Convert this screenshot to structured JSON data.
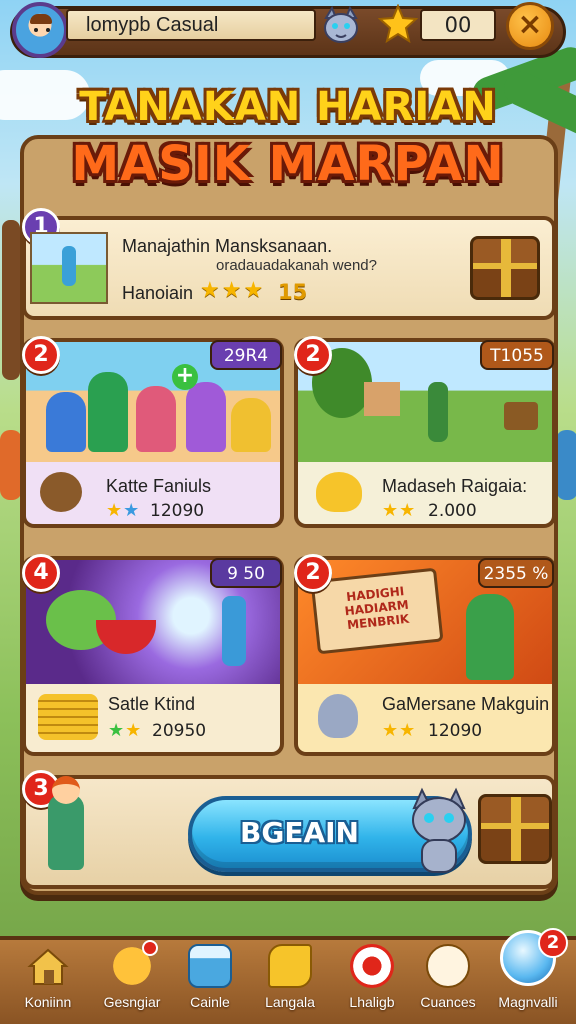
{
  "header": {
    "player_name": "lomypb Casual",
    "score": "00",
    "close_label": "×"
  },
  "titles": {
    "line1": "TANAKAN HARIAN",
    "line2": "MASIK MARPAN"
  },
  "featured_task": {
    "badge": "1",
    "title": "Manajathin Mansksanaan.",
    "subtitle": "oradauadakanah wend?",
    "name": "Hanoiain",
    "stars": "★★★",
    "value": "15"
  },
  "tasks": [
    {
      "badge": "2",
      "tag": "29R4",
      "label": "Katte Faniuls",
      "stars": "★★",
      "value": "12090",
      "tag_color": "#6a3fb0"
    },
    {
      "badge": "2",
      "tag": "T1055",
      "label": "Madaseh Raigaia:",
      "stars": "★★",
      "value": "2.000",
      "tag_color": "#b0581a"
    },
    {
      "badge": "4",
      "tag": "9 50",
      "label": "Satle Ktind",
      "stars": "★★",
      "value": "20950",
      "tag_color": "#5a3aa0"
    },
    {
      "badge": "2",
      "tag": "2355 %",
      "label": "GaMersane Makguin",
      "stars": "★★",
      "value": "12090",
      "tag_color": "#b0581a"
    }
  ],
  "sign_text": "HADIGHI\nHADIARM\nMENBRIK",
  "bottom": {
    "badge": "3",
    "begin_label": "BGEAIN"
  },
  "nav": [
    {
      "label": "Koniinn",
      "icon": "home-icon"
    },
    {
      "label": "Gesngiar",
      "icon": "character-icon"
    },
    {
      "label": "Cainle",
      "icon": "basket-icon"
    },
    {
      "label": "Langala",
      "icon": "cheese-icon"
    },
    {
      "label": "Lhaligb",
      "icon": "target-icon"
    },
    {
      "label": "Cuances",
      "icon": "cat-face-icon"
    },
    {
      "label": "Magnvalli",
      "icon": "crystal-icon",
      "notification": "2"
    }
  ],
  "colors": {
    "frame_brown": "#6b3f17",
    "title_yellow": "#ffd21a",
    "title_orange": "#ff6a1a",
    "button_blue": "#31b4ea",
    "badge_red": "#e0261a",
    "badge_purple": "#6a3fb0"
  }
}
